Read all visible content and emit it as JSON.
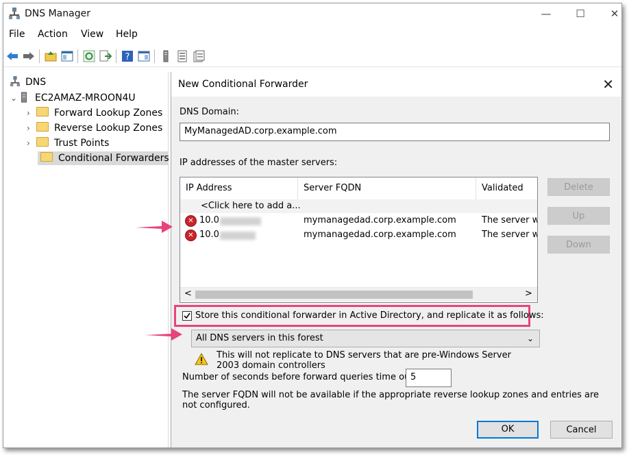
{
  "window": {
    "title": "DNS Manager",
    "controls": {
      "minimize": "—",
      "maximize": "☐",
      "close": "✕"
    }
  },
  "menu": [
    "File",
    "Action",
    "View",
    "Help"
  ],
  "toolbar_icons": [
    "back-icon",
    "forward-icon",
    "up-folder-icon",
    "show-hide-tree-icon",
    "refresh-icon",
    "export-list-icon",
    "help-icon",
    "show-hide-action-pane-icon",
    "server-icon",
    "zone-icon",
    "properties-icon"
  ],
  "tree": {
    "root": "DNS",
    "server": "EC2AMAZ-MROON4U",
    "items": [
      "Forward Lookup Zones",
      "Reverse Lookup Zones",
      "Trust Points",
      "Conditional Forwarders"
    ]
  },
  "dialog": {
    "title": "New Conditional Forwarder",
    "close_glyph": "✕",
    "dns_domain_label": "DNS Domain:",
    "dns_domain_value": "MyManagedAD.corp.example.com",
    "ip_label": "IP addresses of the master servers:",
    "columns": [
      "IP Address",
      "Server FQDN",
      "Validated"
    ],
    "add_row": "<Click here to add a...",
    "rows": [
      {
        "ip": "10.0",
        "fqdn": "mymanagedad.corp.example.com",
        "validated": "The server w"
      },
      {
        "ip": "10.0",
        "fqdn": "mymanagedad.corp.example.com",
        "validated": "The server w"
      }
    ],
    "scroll_left": "<",
    "scroll_right": ">",
    "buttons": {
      "delete": "Delete",
      "up": "Up",
      "down": "Down",
      "ok": "OK",
      "cancel": "Cancel"
    },
    "store_checkbox_label": "Store this conditional forwarder in Active Directory, and replicate it as follows:",
    "store_checked": true,
    "replication_value": "All DNS servers in this forest",
    "warning_text": "This will not replicate to DNS servers that are pre-Windows Server 2003 domain controllers",
    "timeout_label": "Number of seconds before forward queries time out:",
    "timeout_value": "5",
    "footer_note": "The server FQDN will not be available if the appropriate reverse lookup zones and entries are not configured."
  },
  "colors": {
    "highlight": "#e8447a",
    "accent": "#0078d7",
    "error": "#c8252c"
  }
}
